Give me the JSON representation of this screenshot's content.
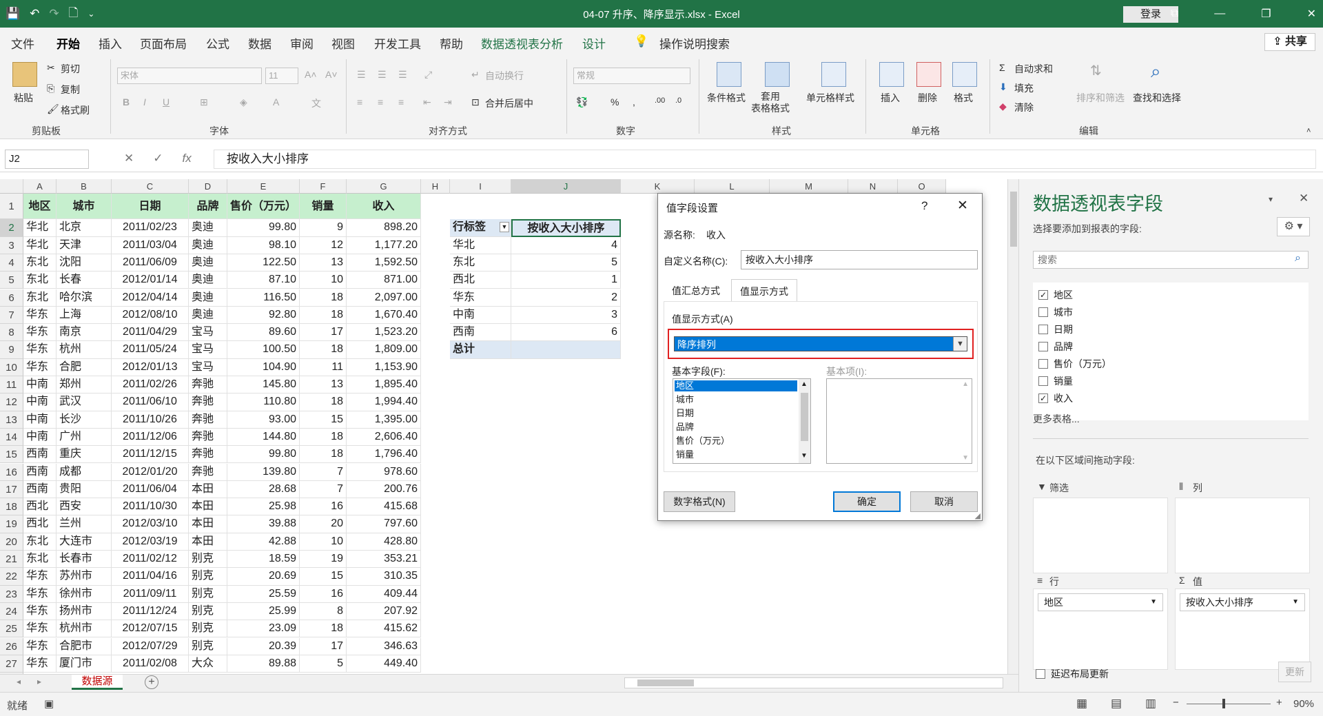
{
  "window": {
    "title": "04-07 升序、降序显示.xlsx  -  Excel",
    "login": "登录"
  },
  "tabs": [
    "文件",
    "开始",
    "插入",
    "页面布局",
    "公式",
    "数据",
    "审阅",
    "视图",
    "开发工具",
    "帮助",
    "数据透视表分析",
    "设计",
    "操作说明搜索"
  ],
  "share": "共享",
  "ribbon": {
    "paste": "粘贴",
    "cut": "剪切",
    "copy": "复制",
    "format_painter": "格式刷",
    "clipboard": "剪贴板",
    "font_name": "宋体",
    "font_size": "11",
    "font": "字体",
    "wrap": "自动换行",
    "merge": "合并后居中",
    "align": "对齐方式",
    "num_format": "常规",
    "number": "数字",
    "cond_format": "条件格式",
    "table_format": "套用\n表格格式",
    "cell_style": "单元格样式",
    "styles": "样式",
    "insert": "插入",
    "delete": "删除",
    "format": "格式",
    "cells": "单元格",
    "autosum": "自动求和",
    "fill": "填充",
    "clear": "清除",
    "sort_filter": "排序和筛选",
    "find_select": "查找和选择",
    "editing": "编辑"
  },
  "formula_bar": {
    "name_box": "J2",
    "content": "按收入大小排序"
  },
  "columns": [
    "A",
    "B",
    "C",
    "D",
    "E",
    "F",
    "G",
    "H",
    "I",
    "J",
    "K",
    "L",
    "M",
    "N",
    "O"
  ],
  "table": {
    "headers": [
      "地区",
      "城市",
      "日期",
      "品牌",
      "售价（万元）",
      "销量",
      "收入"
    ],
    "rows": [
      [
        "华北",
        "北京",
        "2011/02/23",
        "奥迪",
        "99.80",
        "9",
        "898.20"
      ],
      [
        "华北",
        "天津",
        "2011/03/04",
        "奥迪",
        "98.10",
        "12",
        "1,177.20"
      ],
      [
        "东北",
        "沈阳",
        "2011/06/09",
        "奥迪",
        "122.50",
        "13",
        "1,592.50"
      ],
      [
        "东北",
        "长春",
        "2012/01/14",
        "奥迪",
        "87.10",
        "10",
        "871.00"
      ],
      [
        "东北",
        "哈尔滨",
        "2012/04/14",
        "奥迪",
        "116.50",
        "18",
        "2,097.00"
      ],
      [
        "华东",
        "上海",
        "2012/08/10",
        "奥迪",
        "92.80",
        "18",
        "1,670.40"
      ],
      [
        "华东",
        "南京",
        "2011/04/29",
        "宝马",
        "89.60",
        "17",
        "1,523.20"
      ],
      [
        "华东",
        "杭州",
        "2011/05/24",
        "宝马",
        "100.50",
        "18",
        "1,809.00"
      ],
      [
        "华东",
        "合肥",
        "2012/01/13",
        "宝马",
        "104.90",
        "11",
        "1,153.90"
      ],
      [
        "中南",
        "郑州",
        "2011/02/26",
        "奔驰",
        "145.80",
        "13",
        "1,895.40"
      ],
      [
        "中南",
        "武汉",
        "2011/06/10",
        "奔驰",
        "110.80",
        "18",
        "1,994.40"
      ],
      [
        "中南",
        "长沙",
        "2011/10/26",
        "奔驰",
        "93.00",
        "15",
        "1,395.00"
      ],
      [
        "中南",
        "广州",
        "2011/12/06",
        "奔驰",
        "144.80",
        "18",
        "2,606.40"
      ],
      [
        "西南",
        "重庆",
        "2011/12/15",
        "奔驰",
        "99.80",
        "18",
        "1,796.40"
      ],
      [
        "西南",
        "成都",
        "2012/01/20",
        "奔驰",
        "139.80",
        "7",
        "978.60"
      ],
      [
        "西南",
        "贵阳",
        "2011/06/04",
        "本田",
        "28.68",
        "7",
        "200.76"
      ],
      [
        "西北",
        "西安",
        "2011/10/30",
        "本田",
        "25.98",
        "16",
        "415.68"
      ],
      [
        "西北",
        "兰州",
        "2012/03/10",
        "本田",
        "39.88",
        "20",
        "797.60"
      ],
      [
        "东北",
        "大连市",
        "2012/03/19",
        "本田",
        "42.88",
        "10",
        "428.80"
      ],
      [
        "东北",
        "长春市",
        "2011/02/12",
        "别克",
        "18.59",
        "19",
        "353.21"
      ],
      [
        "华东",
        "苏州市",
        "2011/04/16",
        "别克",
        "20.69",
        "15",
        "310.35"
      ],
      [
        "华东",
        "徐州市",
        "2011/09/11",
        "别克",
        "25.59",
        "16",
        "409.44"
      ],
      [
        "华东",
        "扬州市",
        "2011/12/24",
        "别克",
        "25.99",
        "8",
        "207.92"
      ],
      [
        "华东",
        "杭州市",
        "2012/07/15",
        "别克",
        "23.09",
        "18",
        "415.62"
      ],
      [
        "华东",
        "合肥市",
        "2012/07/29",
        "别克",
        "20.39",
        "17",
        "346.63"
      ],
      [
        "华东",
        "厦门市",
        "2011/02/08",
        "大众",
        "89.88",
        "5",
        "449.40"
      ]
    ]
  },
  "pivot": {
    "row_label": "行标签",
    "value_header": "按收入大小排序",
    "rows": [
      [
        "华北",
        "4"
      ],
      [
        "东北",
        "5"
      ],
      [
        "西北",
        "1"
      ],
      [
        "华东",
        "2"
      ],
      [
        "中南",
        "3"
      ],
      [
        "西南",
        "6"
      ]
    ],
    "total": "总计"
  },
  "sheet_tab": "数据源",
  "status": {
    "ready": "就绪",
    "zoom": "90%"
  },
  "field_pane": {
    "title": "数据透视表字段",
    "subtitle": "选择要添加到报表的字段:",
    "search_placeholder": "搜索",
    "fields": [
      {
        "name": "地区",
        "checked": true
      },
      {
        "name": "城市",
        "checked": false
      },
      {
        "name": "日期",
        "checked": false
      },
      {
        "name": "品牌",
        "checked": false
      },
      {
        "name": "售价（万元）",
        "checked": false
      },
      {
        "name": "销量",
        "checked": false
      },
      {
        "name": "收入",
        "checked": true
      }
    ],
    "more_tables": "更多表格...",
    "drag_label": "在以下区域间拖动字段:",
    "filter_zone": "筛选",
    "col_zone": "列",
    "row_zone": "行",
    "val_zone": "值",
    "row_item": "地区",
    "val_item": "按收入大小排序",
    "defer": "延迟布局更新",
    "update": "更新"
  },
  "dialog": {
    "title": "值字段设置",
    "source_label": "源名称:",
    "source_value": "收入",
    "custom_label": "自定义名称(C):",
    "custom_value": "按收入大小排序",
    "tab_summarize": "值汇总方式",
    "tab_show": "值显示方式",
    "show_as_label": "值显示方式(A)",
    "show_as_value": "降序排列",
    "base_field_label": "基本字段(F):",
    "base_item_label": "基本项(I):",
    "base_fields": [
      "地区",
      "城市",
      "日期",
      "品牌",
      "售价（万元）",
      "销量"
    ],
    "number_format": "数字格式(N)",
    "ok": "确定",
    "cancel": "取消"
  }
}
